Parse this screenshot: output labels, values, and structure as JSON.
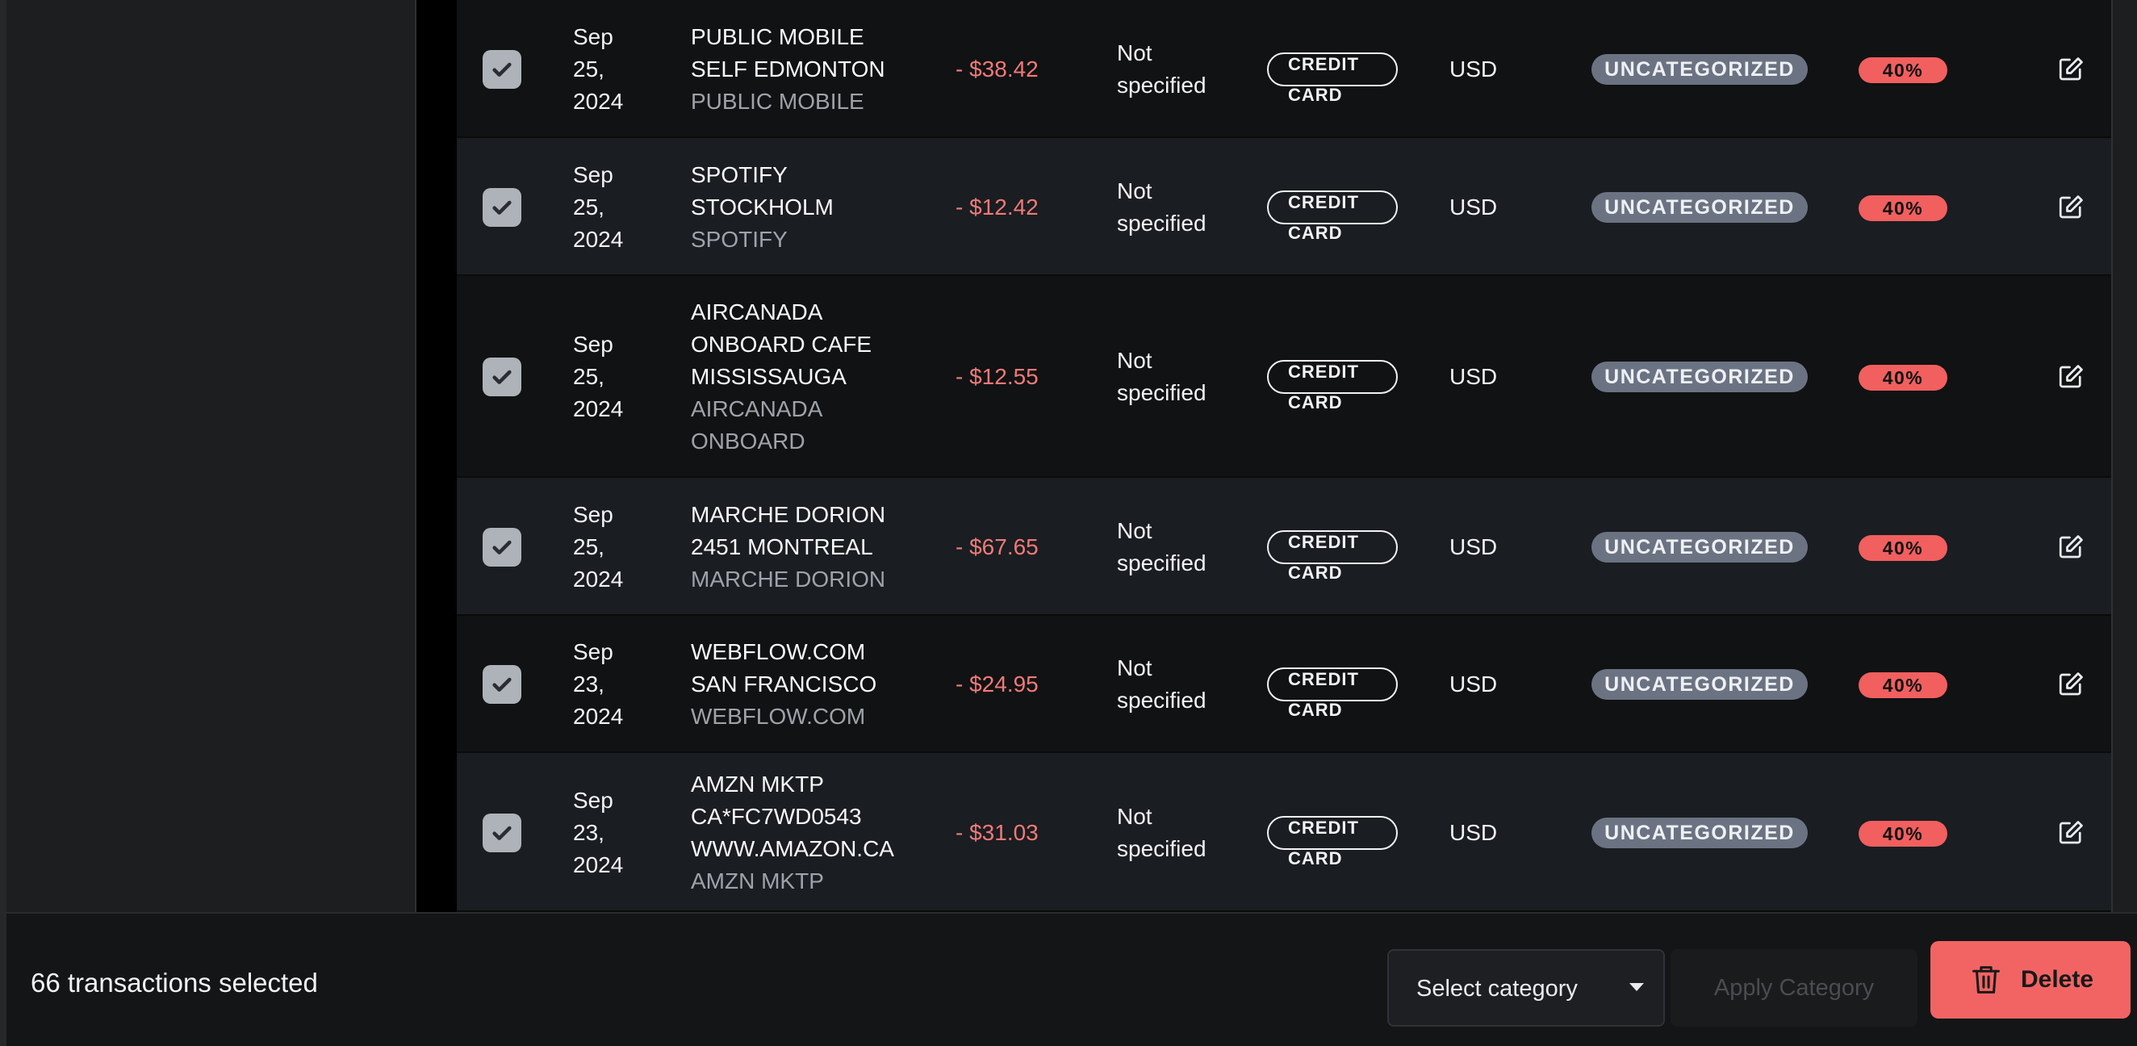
{
  "transactions": [
    {
      "date_line1": "Sep",
      "date_line2": "25,",
      "date_line3": "2024",
      "name_lines": [
        "PUBLIC MOBILE",
        "SELF EDMONTON"
      ],
      "merchant_lines": [
        "PUBLIC MOBILE"
      ],
      "amount": "- $38.42",
      "status_line1": "Not",
      "status_line2": "specified",
      "method": "CREDIT CARD",
      "currency": "USD",
      "category": "UNCATEGORIZED",
      "confidence": "40%"
    },
    {
      "date_line1": "Sep",
      "date_line2": "25,",
      "date_line3": "2024",
      "name_lines": [
        "SPOTIFY",
        "STOCKHOLM"
      ],
      "merchant_lines": [
        "SPOTIFY"
      ],
      "amount": "- $12.42",
      "status_line1": "Not",
      "status_line2": "specified",
      "method": "CREDIT CARD",
      "currency": "USD",
      "category": "UNCATEGORIZED",
      "confidence": "40%"
    },
    {
      "date_line1": "Sep",
      "date_line2": "25,",
      "date_line3": "2024",
      "name_lines": [
        "AIRCANADA",
        "ONBOARD CAFE",
        "MISSISSAUGA"
      ],
      "merchant_lines": [
        "AIRCANADA",
        "ONBOARD"
      ],
      "amount": "- $12.55",
      "status_line1": "Not",
      "status_line2": "specified",
      "method": "CREDIT CARD",
      "currency": "USD",
      "category": "UNCATEGORIZED",
      "confidence": "40%"
    },
    {
      "date_line1": "Sep",
      "date_line2": "25,",
      "date_line3": "2024",
      "name_lines": [
        "MARCHE DORION",
        "2451 MONTREAL"
      ],
      "merchant_lines": [
        "MARCHE DORION"
      ],
      "amount": "- $67.65",
      "status_line1": "Not",
      "status_line2": "specified",
      "method": "CREDIT CARD",
      "currency": "USD",
      "category": "UNCATEGORIZED",
      "confidence": "40%"
    },
    {
      "date_line1": "Sep",
      "date_line2": "23,",
      "date_line3": "2024",
      "name_lines": [
        "WEBFLOW.COM",
        "SAN FRANCISCO"
      ],
      "merchant_lines": [
        "WEBFLOW.COM"
      ],
      "amount": "- $24.95",
      "status_line1": "Not",
      "status_line2": "specified",
      "method": "CREDIT CARD",
      "currency": "USD",
      "category": "UNCATEGORIZED",
      "confidence": "40%"
    },
    {
      "date_line1": "Sep",
      "date_line2": "23,",
      "date_line3": "2024",
      "name_lines": [
        "AMZN MKTP",
        "CA*FC7WD0543",
        "WWW.AMAZON.CA"
      ],
      "merchant_lines": [
        "AMZN MKTP"
      ],
      "amount": "- $31.03",
      "status_line1": "Not",
      "status_line2": "specified",
      "method": "CREDIT CARD",
      "currency": "USD",
      "category": "UNCATEGORIZED",
      "confidence": "40%"
    }
  ],
  "bulk_bar": {
    "selected_text": "66 transactions selected",
    "select_placeholder": "Select category",
    "apply_label": "Apply Category",
    "delete_label": "Delete"
  },
  "icons": {
    "checkbox": "check-icon",
    "edit": "pencil-square-icon",
    "delete": "trash-icon",
    "dropdown": "caret-down-icon"
  },
  "colors": {
    "amount_negative": "#f07a78",
    "category_badge": "#6b7383",
    "confidence_badge": "#f15f5f",
    "delete_button": "#f26464"
  }
}
